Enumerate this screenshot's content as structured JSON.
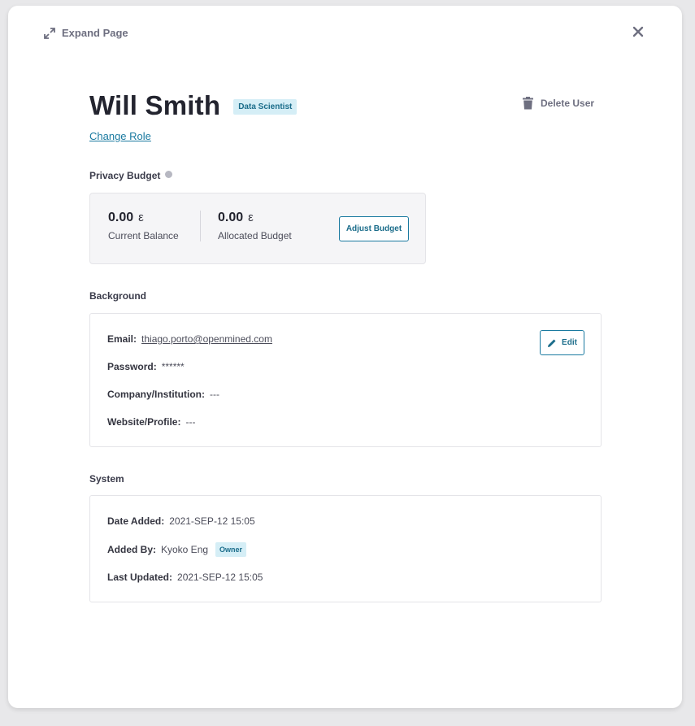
{
  "top_bar": {
    "expand_label": "Expand Page"
  },
  "user": {
    "name": "Will Smith",
    "role": "Data Scientist",
    "change_role_label": "Change Role",
    "delete_label": "Delete User"
  },
  "privacy_budget": {
    "title": "Privacy Budget",
    "current_balance": {
      "value": "0.00",
      "unit": "ε",
      "label": "Current Balance"
    },
    "allocated_budget": {
      "value": "0.00",
      "unit": "ε",
      "label": "Allocated Budget"
    },
    "adjust_label": "Adjust Budget"
  },
  "background": {
    "title": "Background",
    "edit_label": "Edit",
    "email_label": "Email:",
    "email_value": "thiago.porto@openmined.com",
    "password_label": "Password:",
    "password_value": "******",
    "company_label": "Company/Institution:",
    "company_value": "---",
    "website_label": "Website/Profile:",
    "website_value": "---"
  },
  "system": {
    "title": "System",
    "date_added_label": "Date Added:",
    "date_added_value": "2021-SEP-12 15:05",
    "added_by_label": "Added By:",
    "added_by_value": "Kyoko Eng",
    "added_by_badge": "Owner",
    "last_updated_label": "Last Updated:",
    "last_updated_value": "2021-SEP-12 15:05"
  },
  "colors": {
    "accent": "#1a7aa0",
    "badge_bg": "#d5eef6",
    "text_dark": "#23242f",
    "text_muted": "#6e6f80"
  }
}
